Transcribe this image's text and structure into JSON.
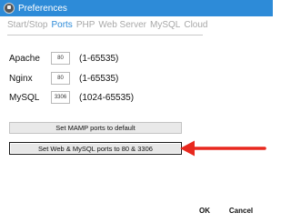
{
  "window": {
    "title": "Preferences"
  },
  "tabs": [
    {
      "label": "Start/Stop",
      "active": false
    },
    {
      "label": "Ports",
      "active": true
    },
    {
      "label": "PHP",
      "active": false
    },
    {
      "label": "Web Server",
      "active": false
    },
    {
      "label": "MySQL",
      "active": false
    },
    {
      "label": "Cloud",
      "active": false
    }
  ],
  "ports": [
    {
      "label": "Apache",
      "value": "80",
      "range": "(1-65535)"
    },
    {
      "label": "Nginx",
      "value": "80",
      "range": "(1-65535)"
    },
    {
      "label": "MySQL",
      "value": "3306",
      "range": "(1024-65535)"
    }
  ],
  "buttons": {
    "default_ports": "Set MAMP ports to default",
    "web_mysql_ports": "Set Web & MySQL ports to 80 & 3306",
    "ok": "OK",
    "cancel": "Cancel"
  },
  "colors": {
    "titlebar": "#2d8bd8",
    "active_tab": "#2d8bd8",
    "arrow": "#e8281e"
  },
  "icons": {
    "app": "mamp-elephant-icon",
    "annotation": "red-arrow-icon"
  }
}
